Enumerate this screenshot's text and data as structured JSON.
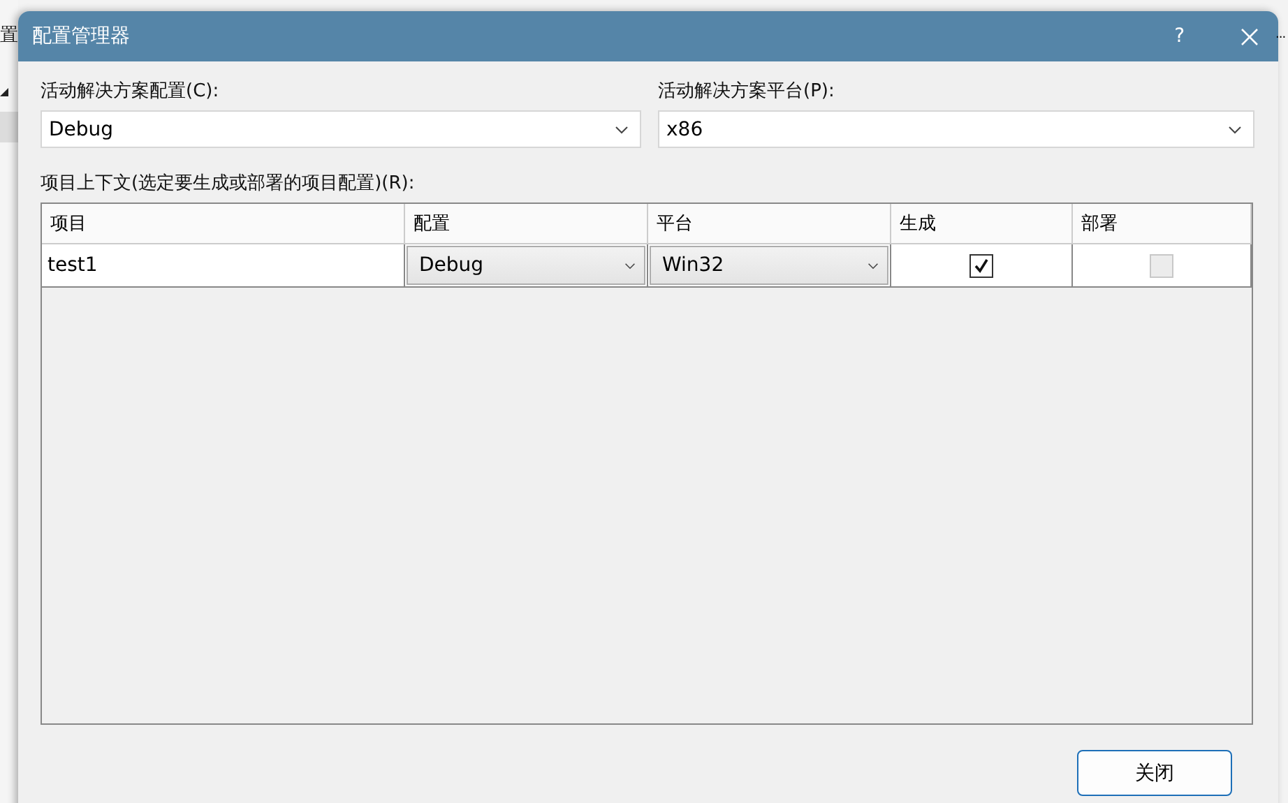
{
  "background": {
    "left_text": "置",
    "right_text": "..."
  },
  "window": {
    "title": "配置管理器",
    "help": "?"
  },
  "config": {
    "label": "活动解决方案配置(C):",
    "value": "Debug"
  },
  "platform": {
    "label": "活动解决方案平台(P):",
    "value": "x86"
  },
  "table": {
    "label": "项目上下文(选定要生成或部署的项目配置)(R):",
    "columns": [
      "项目",
      "配置",
      "平台",
      "生成",
      "部署"
    ],
    "rows": [
      {
        "project": "test1",
        "configuration": "Debug",
        "platform": "Win32",
        "build": {
          "checked": true,
          "disabled": false
        },
        "deploy": {
          "checked": false,
          "disabled": true
        }
      }
    ]
  },
  "buttons": [
    "关闭"
  ]
}
